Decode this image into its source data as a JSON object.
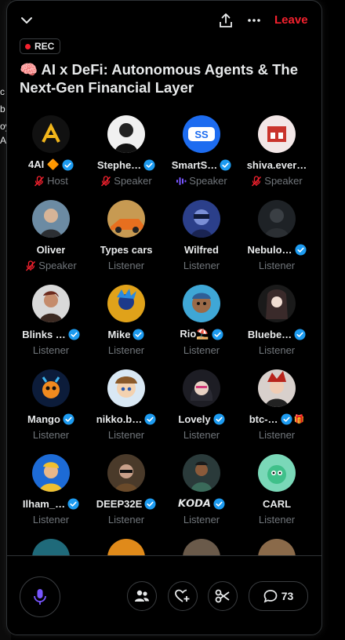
{
  "background_fragments": [
    "c",
    "b",
    "oy",
    "A"
  ],
  "header": {
    "leave_label": "Leave",
    "rec_label": "REC",
    "title": "🧠 AI x DeFi: Autonomous Agents & The Next-Gen Financial Layer"
  },
  "participants": [
    {
      "name": "4AI 🔶",
      "role": "Host",
      "verified": true,
      "role_icon": "muted-mic-icon"
    },
    {
      "name": "Stephe…",
      "role": "Speaker",
      "verified": true,
      "role_icon": "muted-mic-icon"
    },
    {
      "name": "SmartS…",
      "role": "Speaker",
      "verified": true,
      "role_icon": "speaking-wave-icon"
    },
    {
      "name": "shiva.ever…",
      "role": "Speaker",
      "verified": false,
      "role_icon": "muted-mic-icon"
    },
    {
      "name": "Oliver",
      "role": "Speaker",
      "verified": false,
      "role_icon": "muted-mic-icon"
    },
    {
      "name": "Types cars",
      "role": "Listener",
      "verified": false
    },
    {
      "name": "Wilfred",
      "role": "Listener",
      "verified": false
    },
    {
      "name": "Nebulo…",
      "role": "Listener",
      "verified": true
    },
    {
      "name": "Blinks …",
      "role": "Listener",
      "verified": true
    },
    {
      "name": "Mike",
      "role": "Listener",
      "verified": true
    },
    {
      "name": "Rio⛱️",
      "role": "Listener",
      "verified": true
    },
    {
      "name": "Bluebe…",
      "role": "Listener",
      "verified": true
    },
    {
      "name": "Mango",
      "role": "Listener",
      "verified": true
    },
    {
      "name": "nikko.b…",
      "role": "Listener",
      "verified": true
    },
    {
      "name": "Lovely",
      "role": "Listener",
      "verified": true
    },
    {
      "name": "btc-…",
      "role": "Listener",
      "verified": true,
      "extra": "🎁"
    },
    {
      "name": "Ilham_…",
      "role": "Listener",
      "verified": true
    },
    {
      "name": "DEEP32E",
      "role": "Listener",
      "verified": true
    },
    {
      "name": "𝙆𝙊𝘿𝘼",
      "role": "Listener",
      "verified": true
    },
    {
      "name": "CARL",
      "role": "Listener",
      "verified": false
    }
  ],
  "footer": {
    "chat_count": "73"
  },
  "colors": {
    "accent": "#1d9bf0",
    "leave": "#f4212e",
    "mic": "#7856ff",
    "muted_text": "#71767b"
  },
  "icons": [
    "chevron-down-icon",
    "share-icon",
    "more-icon",
    "people-icon",
    "heart-plus-icon",
    "scissors-icon",
    "chat-bubble-icon",
    "microphone-icon"
  ]
}
